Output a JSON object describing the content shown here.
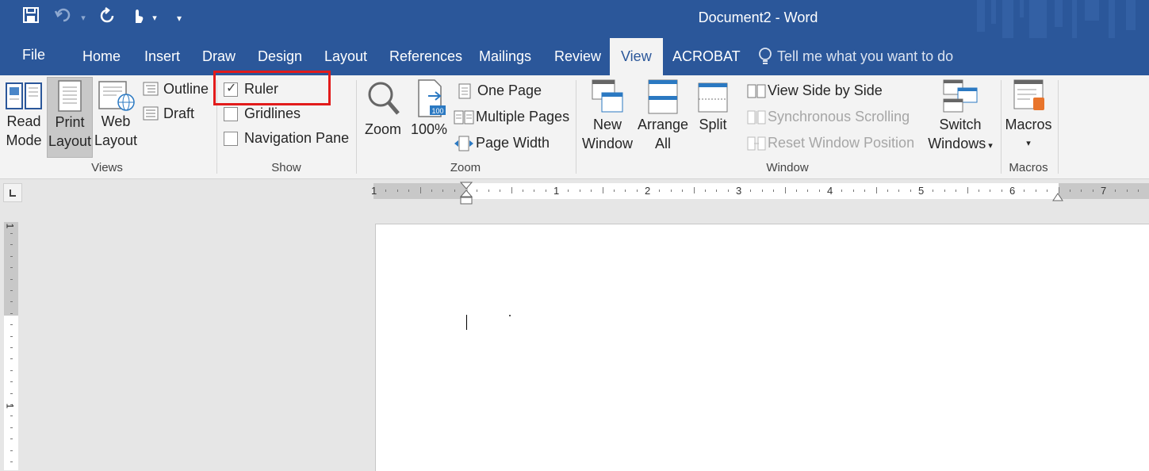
{
  "window": {
    "title": "Document2 - Word"
  },
  "quick_access": {
    "save_icon": "save-icon",
    "undo_icon": "undo-icon",
    "redo_icon": "redo-icon",
    "touch_icon": "touch-mode-icon",
    "customize_icon": "customize-qat-icon"
  },
  "tabs": [
    "File",
    "Home",
    "Insert",
    "Draw",
    "Design",
    "Layout",
    "References",
    "Mailings",
    "Review",
    "View",
    "ACROBAT"
  ],
  "active_tab": "View",
  "tell_me": {
    "placeholder": "Tell me what you want to do"
  },
  "ribbon": {
    "views": {
      "label": "Views",
      "read_mode": [
        "Read",
        "Mode"
      ],
      "print_layout": [
        "Print",
        "Layout"
      ],
      "web_layout": [
        "Web",
        "Layout"
      ],
      "outline": "Outline",
      "draft": "Draft"
    },
    "show": {
      "label": "Show",
      "ruler": "Ruler",
      "ruler_checked": true,
      "gridlines": "Gridlines",
      "gridlines_checked": false,
      "navigation_pane": "Navigation Pane",
      "navigation_pane_checked": false,
      "highlight_color": "#e21b1b"
    },
    "zoom": {
      "label": "Zoom",
      "zoom": "Zoom",
      "hundred": "100%",
      "hundred_badge": "100",
      "one_page": "One Page",
      "multiple_pages": "Multiple Pages",
      "page_width": "Page Width"
    },
    "window": {
      "label": "Window",
      "new_window": [
        "New",
        "Window"
      ],
      "arrange_all": [
        "Arrange",
        "All"
      ],
      "split": "Split",
      "view_side_by_side": "View Side by Side",
      "synchronous_scrolling": "Synchronous Scrolling",
      "reset_window_position": "Reset Window Position",
      "switch_windows": [
        "Switch",
        "Windows"
      ]
    },
    "macros": {
      "label": "Macros",
      "macros": "Macros"
    }
  },
  "ruler": {
    "horizontal_numbers": [
      "1",
      "1",
      "2",
      "3",
      "4",
      "5",
      "6",
      "7"
    ],
    "vertical_numbers": [
      "1",
      "1"
    ]
  },
  "colors": {
    "brand": "#2b579a",
    "ribbon_bg": "#f3f3f3"
  }
}
